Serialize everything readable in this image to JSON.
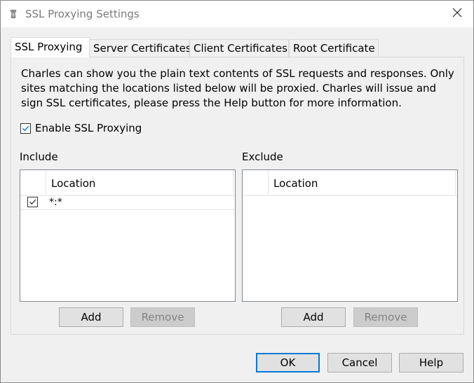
{
  "window": {
    "title": "SSL Proxying Settings",
    "close_icon": "close-icon",
    "app_icon": "charles-app-icon"
  },
  "tabs": [
    {
      "label": "SSL Proxying",
      "active": true
    },
    {
      "label": "Server Certificates",
      "active": false
    },
    {
      "label": "Client Certificates",
      "active": false
    },
    {
      "label": "Root Certificate",
      "active": false
    }
  ],
  "ssl_proxying": {
    "description": "Charles can show you the plain text contents of SSL requests and responses. Only sites matching the locations listed below will be proxied. Charles will issue and sign SSL certificates, please press the Help button for more information.",
    "enable_label": "Enable SSL Proxying",
    "enable_checked": true,
    "include": {
      "label": "Include",
      "column_header": "Location",
      "rows": [
        {
          "checked": true,
          "location": "*:*"
        }
      ],
      "add_label": "Add",
      "remove_label": "Remove"
    },
    "exclude": {
      "label": "Exclude",
      "column_header": "Location",
      "rows": [],
      "add_label": "Add",
      "remove_label": "Remove"
    }
  },
  "footer": {
    "ok_label": "OK",
    "cancel_label": "Cancel",
    "help_label": "Help"
  },
  "colors": {
    "accent": "#0078d7",
    "dialog_bg": "#f0f0f0",
    "disabled_text": "#838383"
  }
}
